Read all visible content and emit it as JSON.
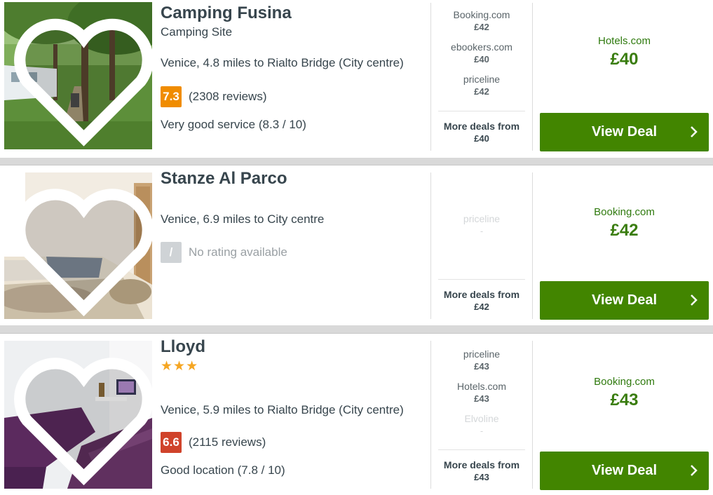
{
  "colors": {
    "accent_green": "#428500",
    "price_green": "#3a7d0f",
    "rating_orange": "#f08c00",
    "rating_red": "#d0432b",
    "rating_none": "#cfd3d6",
    "star_gold": "#f5a623"
  },
  "hotels": [
    {
      "name": "Camping Fusina",
      "type": "Camping Site",
      "location": "Venice, 4.8 miles to Rialto Bridge (City centre)",
      "rating": "7.3",
      "reviews": "(2308 reviews)",
      "description": "Very good service (8.3 / 10)",
      "deals": [
        {
          "site": "Booking.com",
          "price": "£42"
        },
        {
          "site": "ebookers.com",
          "price": "£40"
        },
        {
          "site": "priceline",
          "price": "£42"
        }
      ],
      "more_deals_label": "More deals from",
      "more_deals_price": "£40",
      "best_site": "Hotels.com",
      "best_price": "£40",
      "button_label": "View Deal",
      "photo": "camping-site-photo"
    },
    {
      "name": "Stanze Al Parco",
      "location": "Venice, 6.9 miles to City centre",
      "rating": "/",
      "reviews": "No rating available",
      "deals": [
        {
          "site": "priceline",
          "price": "-"
        }
      ],
      "more_deals_label": "More deals from",
      "more_deals_price": "£42",
      "best_site": "Booking.com",
      "best_price": "£42",
      "button_label": "View Deal",
      "photo": "bedroom-photo"
    },
    {
      "name": "Lloyd",
      "stars": "★★★",
      "location": "Venice, 5.9 miles to Rialto Bridge (City centre)",
      "rating": "6.6",
      "reviews": "(2115 reviews)",
      "description": "Good location (7.8 / 10)",
      "deals": [
        {
          "site": "priceline",
          "price": "£43"
        },
        {
          "site": "Hotels.com",
          "price": "£43"
        },
        {
          "site": "Elvoline",
          "price": "-"
        }
      ],
      "more_deals_label": "More deals from",
      "more_deals_price": "£43",
      "best_site": "Booking.com",
      "best_price": "£43",
      "button_label": "View Deal",
      "photo": "hotel-room-photo"
    }
  ],
  "icons": {
    "favorite": "heart-icon",
    "button_arrow": "chevron-right-icon"
  }
}
